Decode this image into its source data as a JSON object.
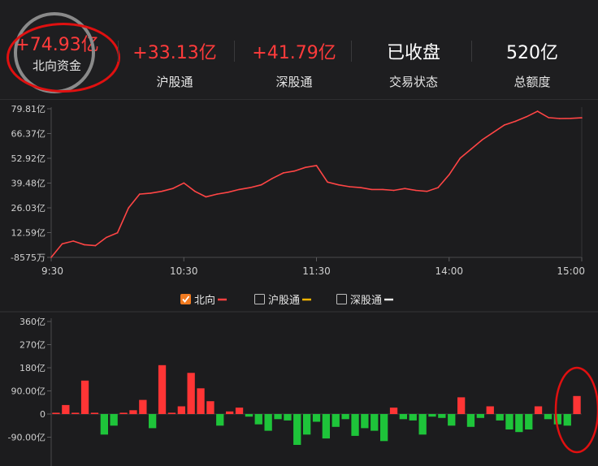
{
  "summary": {
    "northbound": {
      "value": "+74.93亿",
      "label": "北向资金",
      "color": "#ff3b3b"
    },
    "shanghai": {
      "value": "+33.13亿",
      "label": "沪股通",
      "color": "#ff3b3b"
    },
    "shenzhen": {
      "value": "+41.79亿",
      "label": "深股通",
      "color": "#ff3b3b"
    },
    "status": {
      "value": "已收盘",
      "label": "交易状态",
      "color": "#ffffff"
    },
    "quota": {
      "value": "520亿",
      "label": "总额度",
      "color": "#ffffff"
    }
  },
  "legend": {
    "items": [
      {
        "label": "北向",
        "checked": true,
        "swatch": "#ff4040"
      },
      {
        "label": "沪股通",
        "checked": false,
        "swatch": "#f5b400"
      },
      {
        "label": "深股通",
        "checked": false,
        "swatch": "#e8e8e8"
      }
    ]
  },
  "chart_data": [
    {
      "type": "line",
      "series": [
        {
          "name": "北向",
          "color": "#ff4545",
          "x": [
            "9:30",
            "9:35",
            "9:40",
            "9:45",
            "9:50",
            "9:55",
            "10:00",
            "10:05",
            "10:10",
            "10:15",
            "10:20",
            "10:25",
            "10:30",
            "10:35",
            "10:40",
            "10:45",
            "10:50",
            "10:55",
            "11:00",
            "11:05",
            "11:10",
            "11:15",
            "11:20",
            "11:25",
            "11:30",
            "13:05",
            "13:10",
            "13:15",
            "13:20",
            "13:25",
            "13:30",
            "13:35",
            "13:40",
            "13:45",
            "13:50",
            "13:55",
            "14:00",
            "14:05",
            "14:10",
            "14:15",
            "14:20",
            "14:25",
            "14:30",
            "14:35",
            "14:40",
            "14:45",
            "14:50",
            "14:55",
            "15:00"
          ],
          "values": [
            -0.86,
            6.5,
            8.0,
            6.0,
            5.5,
            10.0,
            12.5,
            26.0,
            33.5,
            34.0,
            35.0,
            36.5,
            39.5,
            35.0,
            32.0,
            33.5,
            34.5,
            36.0,
            37.0,
            38.5,
            42.0,
            45.0,
            46.0,
            48.0,
            49.0,
            40.0,
            38.5,
            37.5,
            37.0,
            36.0,
            36.0,
            35.5,
            36.5,
            35.5,
            35.0,
            37.0,
            44.0,
            53.0,
            58.0,
            63.0,
            67.0,
            71.0,
            73.0,
            75.5,
            78.5,
            75.0,
            74.5,
            74.6,
            74.93
          ]
        }
      ],
      "y_ticks": [
        "79.81亿",
        "66.37亿",
        "52.92亿",
        "39.48亿",
        "26.03亿",
        "12.59亿",
        "-8575万"
      ],
      "ylim": [
        -0.86,
        79.81
      ],
      "x_ticks": [
        "9:30",
        "10:30",
        "11:30",
        "14:00",
        "15:00"
      ],
      "unit": "亿"
    },
    {
      "type": "bar",
      "values": [
        5,
        35,
        5,
        130,
        5,
        -80,
        -45,
        5,
        15,
        55,
        -55,
        190,
        5,
        30,
        160,
        100,
        50,
        -45,
        10,
        25,
        -10,
        -40,
        -65,
        -20,
        -25,
        -120,
        -80,
        -30,
        -95,
        -50,
        -20,
        -85,
        -55,
        -65,
        -105,
        25,
        -20,
        -25,
        -80,
        -10,
        -15,
        -45,
        65,
        -50,
        -15,
        30,
        -25,
        -60,
        -70,
        -60,
        30,
        -20,
        -40,
        -45,
        70
      ],
      "y_ticks": [
        "360亿",
        "270亿",
        "180亿",
        "90.00亿",
        "0",
        "-90.00亿"
      ],
      "ylim": [
        -120,
        360
      ],
      "colors": {
        "positive": "#ff3535",
        "negative": "#1ec43a"
      }
    }
  ]
}
